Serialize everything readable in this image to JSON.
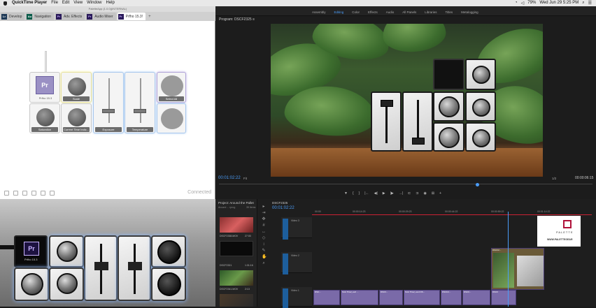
{
  "menubar": {
    "app": "QuickTime Player",
    "items": [
      "File",
      "Edit",
      "View",
      "Window",
      "Help"
    ],
    "battery": "79%",
    "clock": "Wed Jun 29  5:25 PM"
  },
  "palette": {
    "title": "PaletteApp (1.0.0)(INTERNAL)",
    "tabs": [
      {
        "icon": "Lr",
        "label": "Develop"
      },
      {
        "icon": "Au",
        "label": "Navigation"
      },
      {
        "icon": "Pr",
        "label": "Adv. Effects"
      },
      {
        "icon": "Pr",
        "label": "Audio Mixer"
      },
      {
        "icon": "Pr",
        "label": "Prfho 15.3!"
      }
    ],
    "add_tab": "+",
    "modules": {
      "screen_icon": "Pr",
      "screen_label": "Prfho 15.3",
      "scale": "Scale",
      "select_all": "Select All",
      "saturation": "Saturation",
      "current_time": "Current Time Indic...",
      "exposure": "Exposure",
      "temperature": "Temperature"
    },
    "status": "Connected"
  },
  "premiere": {
    "workspaces": [
      "Assembly",
      "Editing",
      "Color",
      "Effects",
      "Audio",
      "All Panels",
      "Libraries",
      "Titles",
      "Metalogging"
    ],
    "active_workspace": "Editing",
    "program_title": "Program: DSCF2325",
    "program_menu": "≡",
    "timecode_current": "00:01:02:22",
    "fit": "Fit",
    "resolution": "1/2",
    "timecode_end": "00:00:06:15",
    "transport": [
      "▼",
      "{",
      "}",
      "|←",
      "◀|",
      "▶",
      "|▶",
      "→|",
      "⊏",
      "⊐",
      "◉",
      "⊞",
      "+"
    ],
    "project_title": "Project: Around the Pallet",
    "project_sub": "Around ... rprog",
    "project_count": "35 Items",
    "project_items": [
      {
        "name": "DSCF2338.MOV",
        "dur": "27:00"
      },
      {
        "name": "DSCF2321",
        "dur": "1:31:16"
      },
      {
        "name": "DSCF2341.MOV",
        "dur": "2:13"
      },
      {
        "name": "",
        "dur": ""
      }
    ],
    "sequence_title": "DSCF2325",
    "sequence_tc": "00:01:02:22",
    "ruler": [
      "00:00",
      "00:00:14:23",
      "00:00:29:23",
      "00:00:44:22",
      "00:00:59:22",
      "00:01:14:22"
    ],
    "tracks": [
      {
        "name": "Video 3",
        "src": "V1"
      },
      {
        "name": "Video 2",
        "src": "V1"
      },
      {
        "name": "Video 1",
        "src": "V1"
      }
    ],
    "clips": [
      "DSC...",
      "Nick Thiery ard ...",
      "DSCF...",
      "Nick Thiery and DS...",
      "DSCF2...",
      "DSCF2...",
      "DSCF...",
      "DSCF"
    ],
    "logo_word": "PALETTE",
    "logo_url": "WWW.PALETTEGEAR"
  }
}
